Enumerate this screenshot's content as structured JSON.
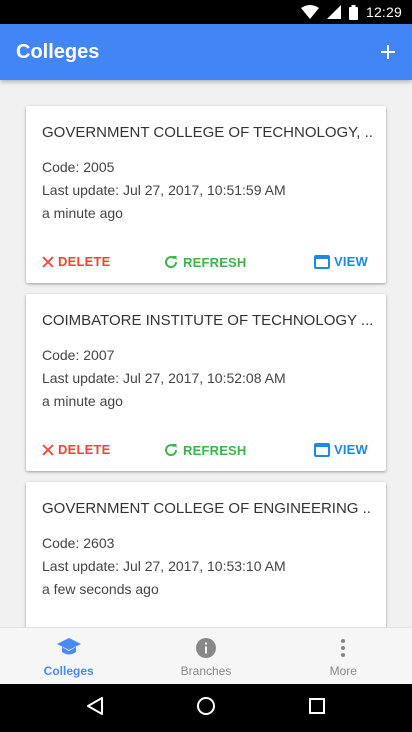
{
  "status_bar": {
    "time": "12:29"
  },
  "app_bar": {
    "title": "Colleges"
  },
  "colleges": [
    {
      "name": "GOVERNMENT COLLEGE OF TECHNOLOGY, ...",
      "code": "Code: 2005",
      "last_update": "Last update: Jul 27, 2017, 10:51:59 AM",
      "relative": "a minute ago"
    },
    {
      "name": "COIMBATORE INSTITUTE OF TECHNOLOGY ...",
      "code": "Code: 2007",
      "last_update": "Last update: Jul 27, 2017, 10:52:08 AM",
      "relative": "a minute ago"
    },
    {
      "name": "GOVERNMENT COLLEGE OF ENGINEERING ...",
      "code": "Code: 2603",
      "last_update": "Last update: Jul 27, 2017, 10:53:10 AM",
      "relative": "a few seconds ago"
    }
  ],
  "actions": {
    "delete": "DELETE",
    "refresh": "REFRESH",
    "view": "VIEW"
  },
  "bottom_nav": {
    "colleges": "Colleges",
    "branches": "Branches",
    "more": "More"
  },
  "colors": {
    "primary": "#4285f4",
    "delete": "#f44336",
    "refresh": "#3ab54a",
    "view": "#1e88e5"
  },
  "icons": [
    "wifi-icon",
    "signal-icon",
    "battery-icon",
    "add-icon",
    "close-icon",
    "refresh-icon",
    "view-icon",
    "school-icon",
    "info-icon",
    "more-vert-icon",
    "back-icon",
    "home-icon",
    "recents-icon"
  ]
}
